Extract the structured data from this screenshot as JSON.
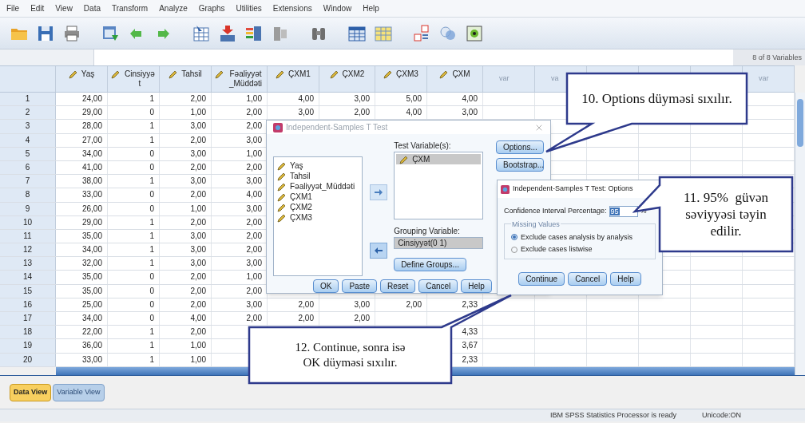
{
  "menu": [
    "File",
    "Edit",
    "View",
    "Data",
    "Transform",
    "Analyze",
    "Graphs",
    "Utilities",
    "Extensions",
    "Window",
    "Help"
  ],
  "cell_editor": {
    "variable_count": "8 of 8 Variables"
  },
  "grid": {
    "columns": [
      {
        "label": "Yaş"
      },
      {
        "label": "Cinsiyyət"
      },
      {
        "label": "Tahsil"
      },
      {
        "label": "Fəaliyyət_Müddəti"
      },
      {
        "label": "ÇXM1"
      },
      {
        "label": "ÇXM2"
      },
      {
        "label": "ÇXM3"
      },
      {
        "label": "ÇXM"
      }
    ],
    "var_columns": [
      "var",
      "va",
      null,
      null,
      null,
      "var"
    ],
    "rows": [
      {
        "number": "1",
        "cells": [
          "24,00",
          "1",
          "2,00",
          "1,00",
          "4,00",
          "3,00",
          "5,00",
          "4,00"
        ]
      },
      {
        "number": "2",
        "cells": [
          "29,00",
          "0",
          "1,00",
          "2,00",
          "3,00",
          "2,00",
          "4,00",
          "3,00"
        ]
      },
      {
        "number": "3",
        "cells": [
          "28,00",
          "1",
          "3,00",
          "2,00",
          null,
          null,
          null,
          null
        ]
      },
      {
        "number": "4",
        "cells": [
          "27,00",
          "1",
          "2,00",
          "3,00",
          null,
          null,
          null,
          null
        ]
      },
      {
        "number": "5",
        "cells": [
          "34,00",
          "0",
          "3,00",
          "1,00",
          null,
          null,
          null,
          null
        ]
      },
      {
        "number": "6",
        "cells": [
          "41,00",
          "0",
          "2,00",
          "2,00",
          null,
          null,
          null,
          null
        ]
      },
      {
        "number": "7",
        "cells": [
          "38,00",
          "1",
          "3,00",
          "3,00",
          null,
          null,
          null,
          null
        ]
      },
      {
        "number": "8",
        "cells": [
          "33,00",
          "0",
          "2,00",
          "4,00",
          null,
          null,
          null,
          null
        ]
      },
      {
        "number": "9",
        "cells": [
          "26,00",
          "0",
          "1,00",
          "3,00",
          null,
          null,
          null,
          null
        ]
      },
      {
        "number": "10",
        "cells": [
          "29,00",
          "1",
          "2,00",
          "2,00",
          null,
          null,
          null,
          null
        ]
      },
      {
        "number": "11",
        "cells": [
          "35,00",
          "1",
          "3,00",
          "2,00",
          null,
          null,
          null,
          null
        ]
      },
      {
        "number": "12",
        "cells": [
          "34,00",
          "1",
          "3,00",
          "2,00",
          null,
          null,
          null,
          null
        ]
      },
      {
        "number": "13",
        "cells": [
          "32,00",
          "1",
          "3,00",
          "3,00",
          null,
          null,
          null,
          null
        ]
      },
      {
        "number": "14",
        "cells": [
          "35,00",
          "0",
          "2,00",
          "1,00",
          null,
          null,
          null,
          null
        ]
      },
      {
        "number": "15",
        "cells": [
          "35,00",
          "0",
          "2,00",
          "2,00",
          null,
          null,
          null,
          null
        ]
      },
      {
        "number": "16",
        "cells": [
          "25,00",
          "0",
          "2,00",
          "3,00",
          "2,00",
          "3,00",
          "2,00",
          "2,33"
        ]
      },
      {
        "number": "17",
        "cells": [
          "34,00",
          "0",
          "4,00",
          "2,00",
          "2,00",
          "2,00",
          null,
          null
        ]
      },
      {
        "number": "18",
        "cells": [
          "22,00",
          "1",
          "2,00",
          null,
          null,
          null,
          null,
          "4,33"
        ]
      },
      {
        "number": "19",
        "cells": [
          "36,00",
          "1",
          "1,00",
          null,
          null,
          null,
          null,
          "3,67"
        ]
      },
      {
        "number": "20",
        "cells": [
          "33,00",
          "1",
          "1,00",
          null,
          null,
          null,
          null,
          "2,33"
        ]
      }
    ]
  },
  "dialog": {
    "title": "Independent-Samples T Test",
    "source_variables": [
      "Yaş",
      "Tahsil",
      "Fəaliyyət_Müddəti",
      "ÇXM1",
      "ÇXM2",
      "ÇXM3"
    ],
    "test_variables_label": "Test Variable(s):",
    "test_variables": [
      {
        "name": "ÇXM",
        "selected": true
      }
    ],
    "grouping_label": "Grouping Variable:",
    "grouping_value": "Cinsiyyət(0 1)",
    "define_groups": "Define Groups...",
    "side_buttons": [
      "Options...",
      "Bootstrap..."
    ],
    "buttons": [
      "OK",
      "Paste",
      "Reset",
      "Cancel",
      "Help"
    ]
  },
  "options_dialog": {
    "title": "Independent-Samples T Test: Options",
    "ci_label": "Confidence Interval Percentage:",
    "ci_value": "95",
    "ci_unit": "%",
    "missing_label": "Missing Values",
    "missing_options": [
      {
        "label": "Exclude cases analysis by analysis",
        "selected": true
      },
      {
        "label": "Exclude cases listwise",
        "selected": false
      }
    ],
    "buttons": [
      "Continue",
      "Cancel",
      "Help"
    ]
  },
  "callouts": [
    {
      "text": "10. Options düyməsi sıxılır."
    },
    {
      "text": "11. 95%  güvən səviyyəsi təyin edilir."
    },
    {
      "text": "12. Continue, sonra isə OK düyməsi sıxılır."
    }
  ],
  "view_tabs": [
    {
      "label": "Data View",
      "selected": true
    },
    {
      "label": "Variable View",
      "selected": false
    }
  ],
  "status_bar": [
    "IBM SPSS Statistics Processor is ready",
    "Unicode:ON"
  ]
}
